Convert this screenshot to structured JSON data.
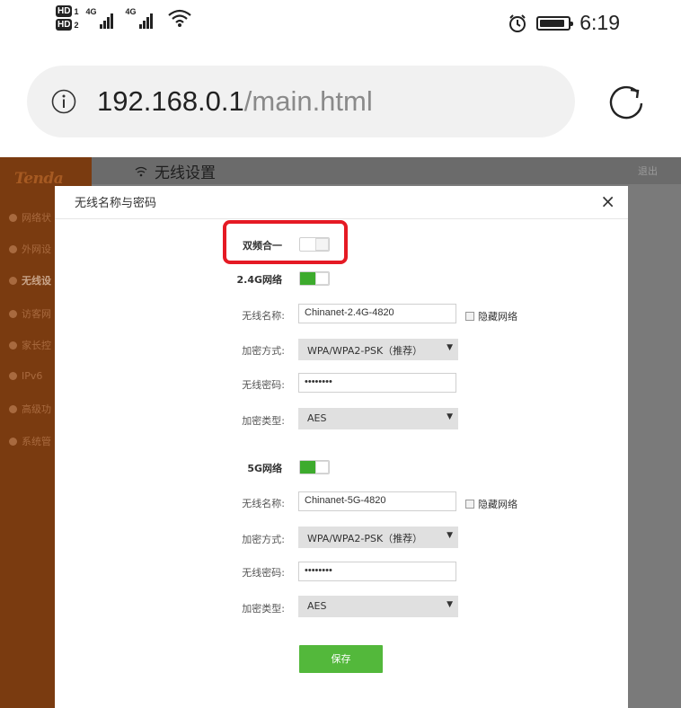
{
  "status_bar": {
    "sim1_badge": "HD",
    "sim1_num": "1",
    "sim2_badge": "HD",
    "sim2_num": "2",
    "sim1_network": "4G",
    "sim2_network": "4G",
    "time": "6:19",
    "battery_level": 0.9,
    "icons": [
      "signal-icon",
      "wifi-icon",
      "alarm-icon",
      "battery-icon"
    ]
  },
  "url_bar": {
    "host": "192.168.0.1",
    "path": "/main.html"
  },
  "router": {
    "logo": "Tenda",
    "top_title": "无线设置",
    "logout": "退出",
    "nav": [
      {
        "label": "网络状",
        "icon": "status-icon"
      },
      {
        "label": "外网设",
        "icon": "globe-icon"
      },
      {
        "label": "无线设",
        "icon": "wifi-icon",
        "active": true
      },
      {
        "label": "访客网",
        "icon": "guest-icon"
      },
      {
        "label": "家长控",
        "icon": "parental-icon"
      },
      {
        "label": "IPv6",
        "icon": "ipv6-icon"
      },
      {
        "label": "高级功",
        "icon": "advanced-icon"
      },
      {
        "label": "系统管",
        "icon": "system-icon"
      }
    ]
  },
  "modal": {
    "title": "无线名称与密码",
    "close": "×",
    "dual_band": {
      "label": "双频合一",
      "enabled": false
    },
    "band_24g": {
      "label": "2.4G网络",
      "enabled": true,
      "ssid_label": "无线名称:",
      "ssid": "Chinanet-2.4G-4820",
      "hide_label": "隐藏网络",
      "hidden": false,
      "security_label": "加密方式:",
      "security": "WPA/WPA2-PSK（推荐）",
      "password_label": "无线密码:",
      "password_masked": "••••••••",
      "cipher_label": "加密类型:",
      "cipher": "AES"
    },
    "band_5g": {
      "label": "5G网络",
      "enabled": true,
      "ssid_label": "无线名称:",
      "ssid": "Chinanet-5G-4820",
      "hide_label": "隐藏网络",
      "hidden": false,
      "security_label": "加密方式:",
      "security": "WPA/WPA2-PSK（推荐）",
      "password_label": "无线密码:",
      "password_masked": "••••••••",
      "cipher_label": "加密类型:",
      "cipher": "AES"
    },
    "save": "保存"
  },
  "colors": {
    "sidebar": "#7a3b10",
    "overlay": "#7a7a7a",
    "toggle_on": "#3dab2d",
    "save_button": "#53b83b",
    "highlight": "#e51a24"
  }
}
